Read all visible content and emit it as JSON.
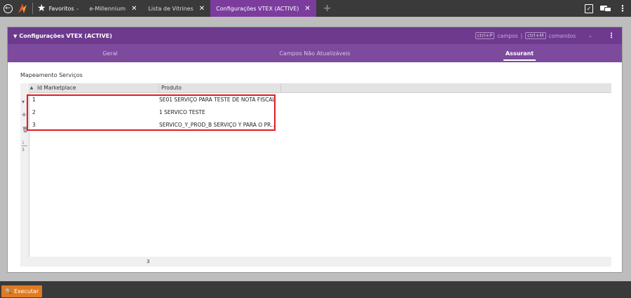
{
  "topbar": {
    "favorites_label": "Favoritos",
    "favorites_caret": "⌄",
    "tabs": [
      {
        "label": "e-Millennium",
        "active": false
      },
      {
        "label": "Lista de Vitrines",
        "active": false
      },
      {
        "label": "Configurações VTEX (ACTIVE)",
        "active": true
      }
    ],
    "close_glyph": "✕",
    "add_tab_glyph": "+"
  },
  "panel": {
    "title": "Configurações VTEX (ACTIVE)",
    "hint_fields_key": "ctrl+P",
    "hint_fields_label": "campos",
    "hint_divider": "|",
    "hint_commands_key": "ctrl+M",
    "hint_commands_label": "comandos",
    "tabs": [
      {
        "label": "Geral",
        "active": false
      },
      {
        "label": "Campos Não Atualizáveis",
        "active": false
      },
      {
        "label": "Assurant",
        "active": true
      }
    ]
  },
  "section": {
    "label": "Mapeamento Serviços"
  },
  "grid": {
    "columns": [
      "Id Marketplace",
      "Produto"
    ],
    "rows": [
      {
        "id": "1",
        "produto": "SE01 SERVIÇO PARA TESTE DE NOTA FISCAL"
      },
      {
        "id": "2",
        "produto": "1 SERVICO TESTE"
      },
      {
        "id": "3",
        "produto": "SERVICO_Y_PROD_B SERVIÇO Y PARA O PRO..."
      }
    ],
    "page_current": "1",
    "page_total": "3",
    "footer_count": "3"
  },
  "bottombar": {
    "run_label": "Executar"
  },
  "colors": {
    "accent_purple": "#6d3a8e",
    "active_tab": "#7b3c9e",
    "run_button": "#e07b1f",
    "highlight_red": "#e01b24"
  },
  "icons": [
    "back-arrow-icon",
    "logo-icon",
    "star-icon",
    "clipboard-icon",
    "chat-icon",
    "kebab-menu-icon",
    "triangle-down-icon",
    "plus-icon",
    "trash-icon",
    "search-icon",
    "keyboard-icon"
  ]
}
